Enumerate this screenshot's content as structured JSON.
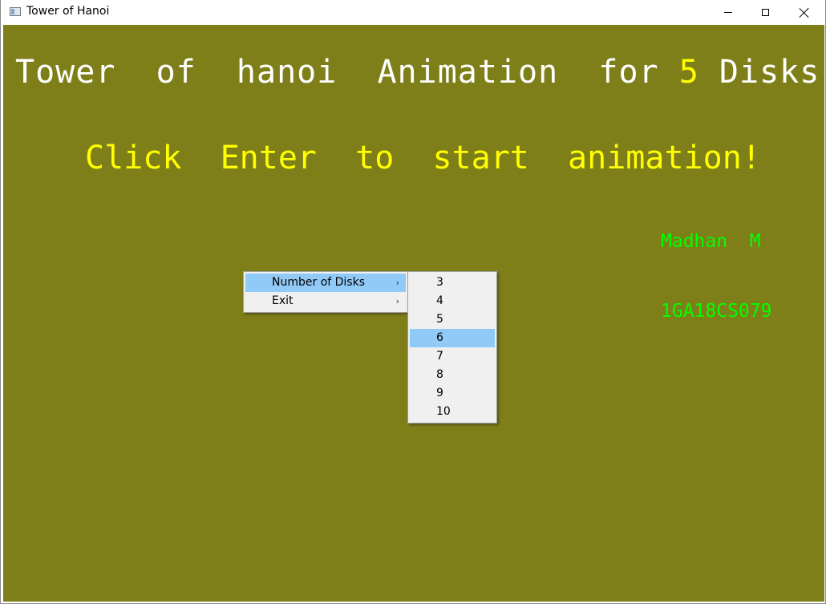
{
  "window": {
    "title": "Tower of Hanoi",
    "controls": {
      "minimize": "minimize",
      "maximize": "maximize",
      "close": "close"
    }
  },
  "canvas": {
    "heading_prefix": "Tower  of  hanoi  Animation  for ",
    "disk_count": "5",
    "heading_suffix": "Disks",
    "instruction": "Click  Enter  to  start  animation!",
    "author_name": "Madhan  M",
    "author_usn": "1GA18CS079"
  },
  "context_menu": {
    "items": [
      {
        "label": "Number of Disks",
        "has_submenu": true,
        "highlighted": true
      },
      {
        "label": "Exit",
        "has_submenu": true,
        "highlighted": false
      }
    ],
    "submenu_arrow": "›"
  },
  "submenu": {
    "items": [
      "3",
      "4",
      "5",
      "6",
      "7",
      "8",
      "9",
      "10"
    ],
    "highlighted": "6"
  },
  "colors": {
    "background": "#7f7f1a",
    "heading": "#ffffff",
    "accent_yellow": "#ffff00",
    "author_green": "#00ff00",
    "menu_highlight": "#91c9f7"
  }
}
